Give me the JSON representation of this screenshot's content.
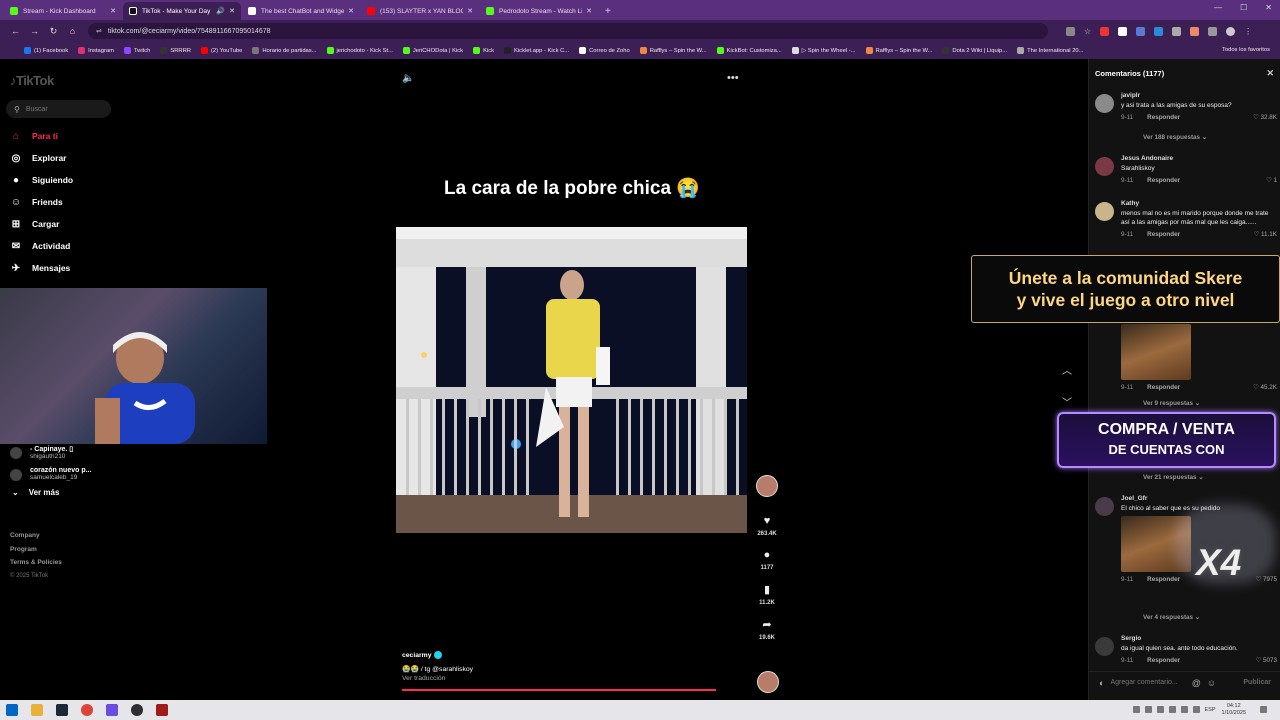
{
  "browser": {
    "tabs": [
      {
        "label": "Stream - Kick Dashboard",
        "fav": "#53fc18",
        "active": false
      },
      {
        "label": "TikTok - Make Your Day",
        "fav": "#000000",
        "active": true
      },
      {
        "label": "The best ChatBot and Widgets",
        "fav": "#ffffff",
        "active": false
      },
      {
        "label": "(153) SLAYTER x YAN BLOCK x",
        "fav": "#ff0000",
        "active": false
      },
      {
        "label": "Pedrodoto Stream - Watch Live",
        "fav": "#53fc18",
        "active": false
      }
    ],
    "url": "tiktok.com/@ceciarmy/video/7548911667095014678",
    "bookmarks": [
      "(1) Facebook",
      "Instagram",
      "Twitch",
      "SRRRR",
      "(2) YouTube",
      "Horario de partidas...",
      "jerichodoto - Kick St...",
      "JeriCHODota | Kick",
      "Kick",
      "Kicklet.app - Kick C...",
      "Correo de Zoho",
      "Rafflys – Spin the W...",
      "KickBot: Customiza...",
      "▷ Spin the Wheel -...",
      "Rafflys – Spin the W...",
      "Dota 2 Wiki | Liquip...",
      "The International 20..."
    ],
    "bookmarks_right": "Todos los favoritos"
  },
  "sidebar": {
    "logo": "TikTok",
    "search_placeholder": "Buscar",
    "nav": [
      {
        "label": "Para ti",
        "icon": "home-icon",
        "glyph": "⌂",
        "active": true
      },
      {
        "label": "Explorar",
        "icon": "compass-icon",
        "glyph": "◎",
        "active": false
      },
      {
        "label": "Siguiendo",
        "icon": "following-icon",
        "glyph": "●",
        "active": false
      },
      {
        "label": "Friends",
        "icon": "friends-icon",
        "glyph": "☺",
        "active": false
      },
      {
        "label": "Cargar",
        "icon": "upload-icon",
        "glyph": "⊞",
        "active": false
      },
      {
        "label": "Actividad",
        "icon": "activity-icon",
        "glyph": "✉",
        "active": false
      },
      {
        "label": "Mensajes",
        "icon": "messages-icon",
        "glyph": "✈",
        "active": false
      }
    ],
    "following": [
      {
        "name": "- Capinaye. ▯",
        "handle": "shigauth210"
      },
      {
        "name": "corazón nuevo p...",
        "handle": "samuelcaleb_19"
      }
    ],
    "ver_mas": "Ver más",
    "footer": {
      "company": "Company",
      "program": "Program",
      "terms": "Terms & Policies",
      "copyright": "© 2025 TikTok"
    }
  },
  "video": {
    "caption": "La cara de la pobre chica 😭",
    "likes": "263.4K",
    "comments": "1177",
    "saves": "11.2K",
    "shares": "19.6K",
    "author": "ceciarmy",
    "description": "😭😭 / tg @sarahliskoy",
    "translate": "Ver traducción"
  },
  "comments": {
    "header": "Comentarios (1177)",
    "items": [
      {
        "name": "javiplr",
        "text": "y asi trata a las amigas de su esposa?",
        "date": "9-11",
        "reply": "Responder",
        "likes": "32.8K"
      },
      {
        "name": "Jesus Andonaire",
        "text": "Sarahliskoy",
        "date": "9-11",
        "reply": "Responder",
        "likes": "1"
      },
      {
        "name": "Kathy",
        "text": "menos mal no es mi marido porque donde me trate así a las amigas por más mal que les caiga......",
        "date": "9-11",
        "reply": "Responder",
        "likes": "11.1K"
      },
      {
        "name": "",
        "text": "",
        "date": "9-11",
        "reply": "Responder",
        "likes": "45.2K"
      },
      {
        "name": "Joel_Gfr",
        "text": "El chico al saber que es su pedido",
        "date": "9-11",
        "reply": "Responder",
        "likes": "7975"
      },
      {
        "name": "Sergio",
        "text": "da igual quien sea. ante todo educación.",
        "date": "9-11",
        "reply": "Responder",
        "likes": "5073"
      }
    ],
    "replies": [
      "Ver 188 respuestas",
      "Ver 9 respuestas",
      "Ver 21 respuestas",
      "Ver 4 respuestas"
    ],
    "input_placeholder": "Agregar comentario...",
    "publish": "Publicar"
  },
  "overlays": {
    "promo1_line1": "Únete a la comunidad Skere",
    "promo1_line2": "y vive el juego a otro nivel",
    "promo2_line1": "COMPRA / VENTA",
    "promo2_line2": "DE CUENTAS CON",
    "badge": "X4"
  },
  "taskbar": {
    "lang": "ESP",
    "time": "04:12",
    "date": "1/10/2025"
  }
}
